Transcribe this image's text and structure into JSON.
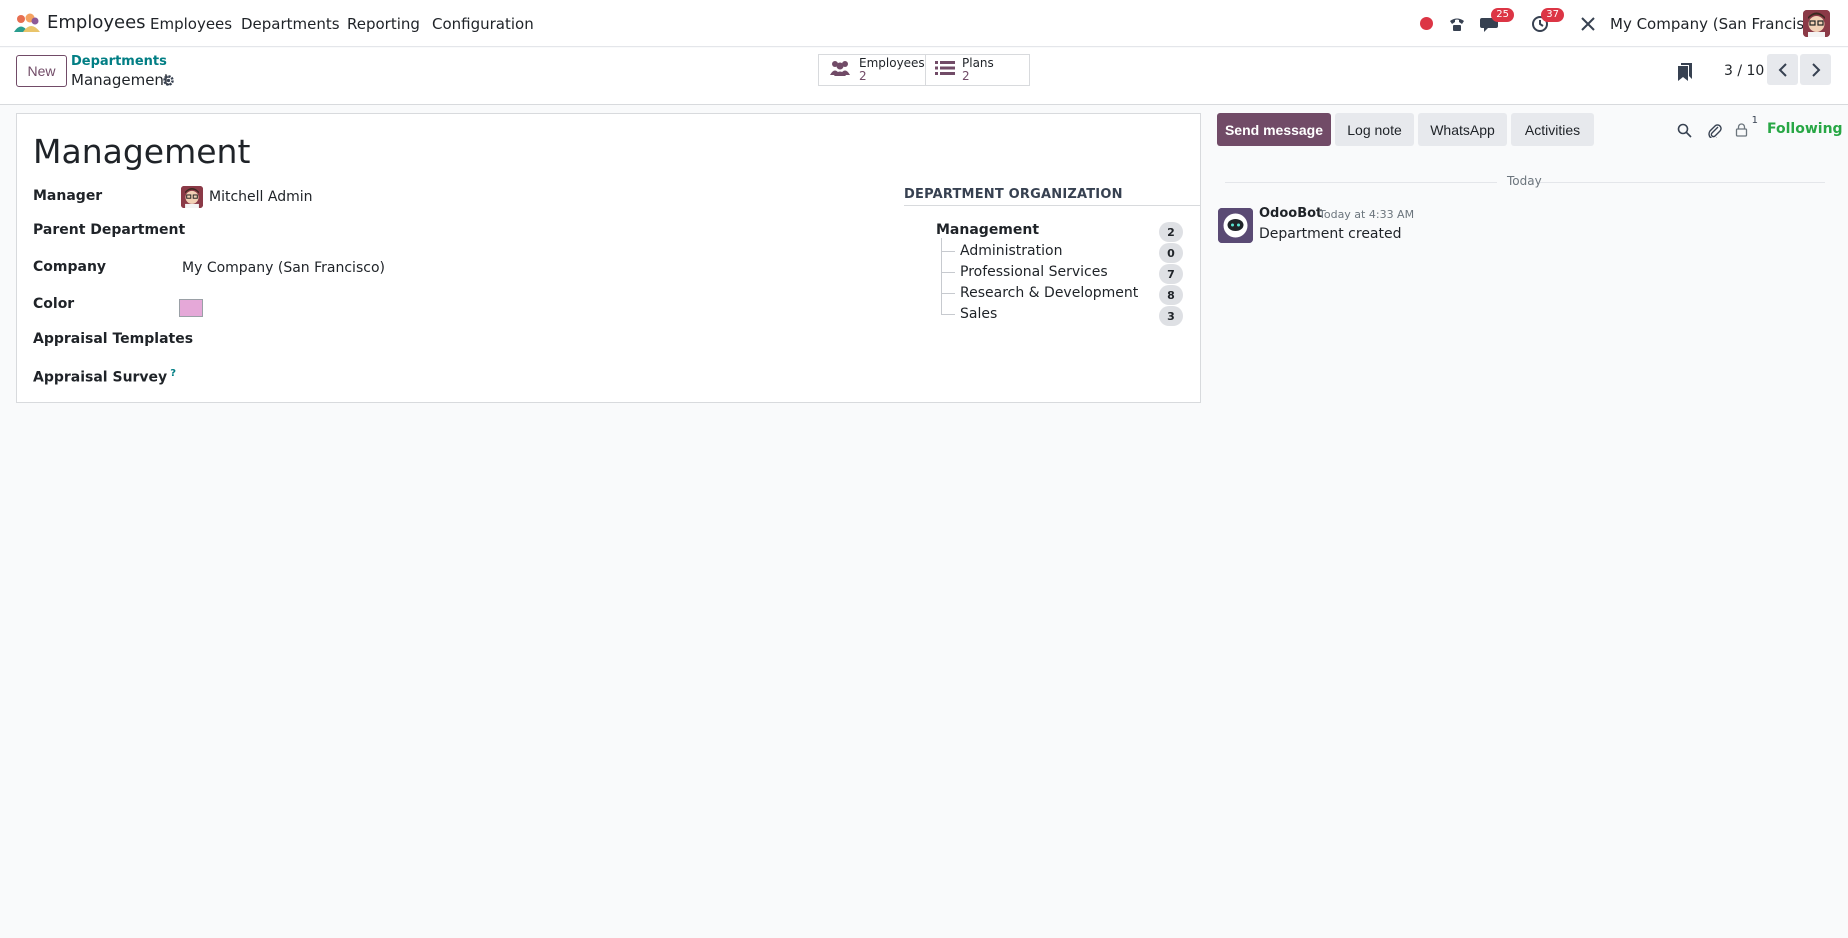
{
  "navbar": {
    "app_name": "Employees",
    "menus": [
      "Employees",
      "Departments",
      "Reporting",
      "Configuration"
    ],
    "messages_badge": "25",
    "activities_badge": "37",
    "company": "My Company (San Francisco)",
    "icons": [
      "app-logo-icon",
      "phone-icon",
      "chat-icon",
      "clock-icon",
      "tools-icon"
    ],
    "recording_color": "#dc3545"
  },
  "control": {
    "new_label": "New",
    "breadcrumb_parent": "Departments",
    "breadcrumb_current": "Management",
    "smart_buttons": [
      {
        "label": "Employees",
        "value": "2",
        "icon": "users-icon"
      },
      {
        "label": "Plans",
        "value": "2",
        "icon": "list-icon"
      }
    ],
    "pager": "3 / 10"
  },
  "form": {
    "title": "Management",
    "fields": [
      {
        "label": "Manager",
        "value": "Mitchell Admin"
      },
      {
        "label": "Parent Department",
        "value": ""
      },
      {
        "label": "Company",
        "value": "My Company (San Francisco)"
      },
      {
        "label": "Color",
        "value": ""
      },
      {
        "label": "Appraisal Templates",
        "value": ""
      },
      {
        "label": "Appraisal Survey",
        "value": "",
        "help": "?"
      }
    ],
    "color_value": "#e5a8d8",
    "org": {
      "heading": "DEPARTMENT ORGANIZATION",
      "root": {
        "name": "Management",
        "count": "2"
      },
      "children": [
        {
          "name": "Administration",
          "count": "0"
        },
        {
          "name": "Professional Services",
          "count": "7"
        },
        {
          "name": "Research & Development",
          "count": "8"
        },
        {
          "name": "Sales",
          "count": "3"
        }
      ]
    }
  },
  "chatter": {
    "send_message": "Send message",
    "log_note": "Log note",
    "whatsapp": "WhatsApp",
    "activities": "Activities",
    "followers_count": "1",
    "following": "Following",
    "date_separator": "Today",
    "messages": [
      {
        "author": "OdooBot",
        "time": "Today at 4:33 AM",
        "body": "Department created"
      }
    ]
  },
  "colors": {
    "brand": "#714b67",
    "link": "#017e84",
    "success": "#28a745",
    "danger": "#dc3545"
  }
}
